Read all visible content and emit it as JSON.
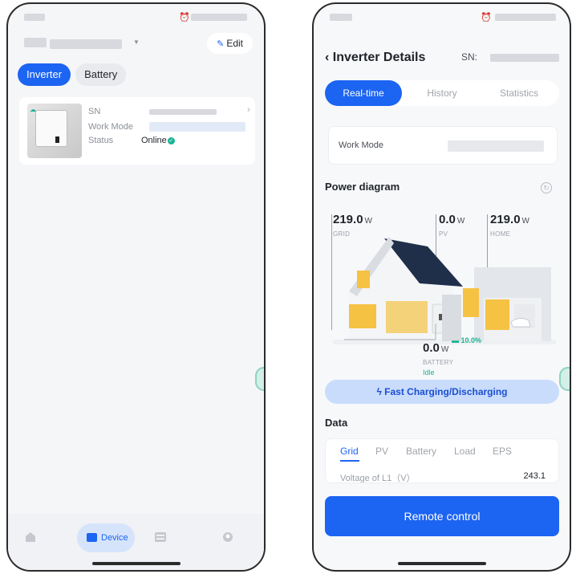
{
  "left": {
    "header": {
      "edit_label": "Edit"
    },
    "tabs": [
      {
        "label": "Inverter"
      },
      {
        "label": "Battery"
      }
    ],
    "device": {
      "sn_label": "SN",
      "work_mode_label": "Work Mode",
      "status_label": "Status",
      "status_value": "Online"
    },
    "nav": {
      "device_label": "Device"
    }
  },
  "right": {
    "header": {
      "title": "Inverter Details",
      "sn_label": "SN:"
    },
    "segments": [
      {
        "label": "Real-time"
      },
      {
        "label": "History"
      },
      {
        "label": "Statistics"
      }
    ],
    "work_mode_label": "Work Mode",
    "power_diagram": {
      "title": "Power diagram",
      "grid": {
        "value": "219.0",
        "unit": "W",
        "label": "GRID"
      },
      "pv": {
        "value": "0.0",
        "unit": "W",
        "label": "PV"
      },
      "home": {
        "value": "219.0",
        "unit": "W",
        "label": "HOME"
      },
      "battery": {
        "value": "0.0",
        "unit": "W",
        "label": "BATTERY",
        "state": "Idle",
        "soc": "10.0%"
      }
    },
    "fast_button": "Fast Charging/Discharging",
    "data": {
      "title": "Data",
      "tabs": [
        {
          "label": "Grid"
        },
        {
          "label": "PV"
        },
        {
          "label": "Battery"
        },
        {
          "label": "Load"
        },
        {
          "label": "EPS"
        }
      ],
      "rows": [
        {
          "label": "Voltage of L1（V）",
          "value": "243.1"
        }
      ]
    },
    "remote_button": "Remote control"
  },
  "colors": {
    "accent": "#1c64f2",
    "success": "#19b394"
  }
}
